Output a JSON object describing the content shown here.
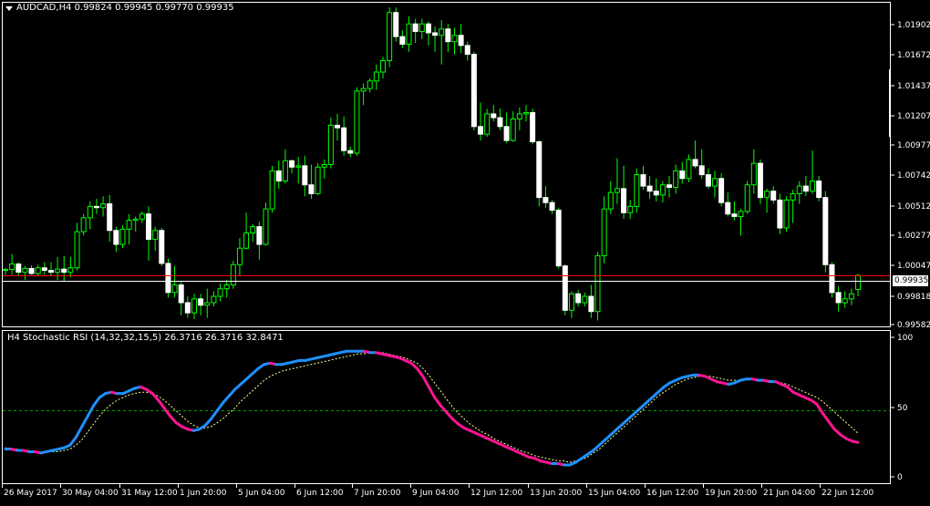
{
  "main_chart": {
    "header": "AUDCAD,H4  0.99824 0.99945 0.99770 0.99935",
    "price_labels": [
      "1.01902",
      "1.01672",
      "1.01437",
      "1.01207",
      "1.00977",
      "1.00742",
      "1.00512",
      "1.00277",
      "1.00047",
      "0.99818",
      "0.99582"
    ],
    "current_price": "0.99935",
    "bid_line_color": "#ffffff",
    "red_line_color": "#ff0000",
    "bull_color": "#ffffff",
    "bear_color": "#ffffff",
    "wick_color": "#00ff00"
  },
  "indicator": {
    "header": "H4 Stochastic RSI (14,32,32,15,5) 26.3716 26.3716 32.8471",
    "levels": [
      "100",
      "50",
      "0"
    ],
    "rising_color": "#1e90ff",
    "falling_color": "#ff1493",
    "signal_color": "#ffff99",
    "level_line_color": "#00a000"
  },
  "time_axis": {
    "labels": [
      "26 May 2017",
      "30 May 04:00",
      "31 May 12:00",
      "1 Jun 20:00",
      "5 Jun 04:00",
      "6 Jun 12:00",
      "7 Jun 20:00",
      "9 Jun 04:00",
      "12 Jun 12:00",
      "13 Jun 20:00",
      "15 Jun 04:00",
      "16 Jun 12:00",
      "19 Jun 20:00",
      "21 Jun 04:00",
      "22 Jun 12:00"
    ]
  },
  "chart_data": [
    {
      "type": "candlestick",
      "title": "AUDCAD,H4",
      "ylim": [
        0.9954,
        1.0208
      ],
      "candles": [
        [
          0.99982,
          0.99995,
          0.9994,
          0.99982
        ],
        [
          0.99982,
          1.00105,
          0.9994,
          1.00025
        ],
        [
          1.00025,
          1.0004,
          0.99935,
          0.9996
        ],
        [
          0.9996,
          1.0001,
          0.999,
          0.9999
        ],
        [
          0.9999,
          1.00015,
          0.9994,
          0.9995
        ],
        [
          0.9995,
          1.0002,
          0.99935,
          0.99995
        ],
        [
          0.99995,
          1.0004,
          0.9994,
          0.99975
        ],
        [
          0.99975,
          1.0004,
          0.9993,
          0.9996
        ],
        [
          0.9996,
          1.0008,
          0.999,
          0.99985
        ],
        [
          0.99985,
          1.0009,
          0.9989,
          0.9996
        ],
        [
          0.9996,
          1.0008,
          0.9992,
          0.99995
        ],
        [
          0.99995,
          1.0035,
          0.99975,
          1.0028
        ],
        [
          1.0028,
          1.0042,
          1.0025,
          1.0039
        ],
        [
          1.0039,
          1.0052,
          1.003,
          1.0048
        ],
        [
          1.0048,
          1.0054,
          1.0042,
          1.0047
        ],
        [
          1.0047,
          1.0056,
          1.004,
          1.005
        ],
        [
          1.005,
          1.0057,
          1.002,
          1.0029
        ],
        [
          1.0029,
          1.0032,
          1.0012,
          1.0018
        ],
        [
          1.0018,
          1.0033,
          1.0015,
          1.003
        ],
        [
          1.003,
          1.0042,
          1.0018,
          1.0037
        ],
        [
          1.0037,
          1.004,
          1.0028,
          1.0038
        ],
        [
          1.0038,
          1.0044,
          1.0035,
          1.0042
        ],
        [
          1.0042,
          1.0048,
          1.0005,
          1.0022
        ],
        [
          1.0022,
          1.0032,
          1.0013,
          1.0029
        ],
        [
          1.0029,
          1.0031,
          1.0001,
          1.0003
        ],
        [
          1.0003,
          1.0007,
          0.9976,
          0.998
        ],
        [
          0.998,
          1.0001,
          0.9976,
          0.9986
        ],
        [
          0.9986,
          0.9989,
          0.9962,
          0.9972
        ],
        [
          0.9972,
          0.9977,
          0.996,
          0.9964
        ],
        [
          0.9964,
          0.9979,
          0.9959,
          0.9975
        ],
        [
          0.9975,
          0.9979,
          0.9962,
          0.997
        ],
        [
          0.997,
          0.9983,
          0.996,
          0.9972
        ],
        [
          0.9972,
          0.9981,
          0.9969,
          0.9977
        ],
        [
          0.9977,
          0.9987,
          0.9973,
          0.9983
        ],
        [
          0.9983,
          0.999,
          0.9976,
          0.9986
        ],
        [
          0.9986,
          1.0005,
          0.9983,
          1.0002
        ],
        [
          1.0002,
          1.0023,
          0.9993,
          1.0015
        ],
        [
          1.0015,
          1.0043,
          1.0014,
          1.0027
        ],
        [
          1.0027,
          1.0034,
          1.002,
          1.0032
        ],
        [
          1.0032,
          1.0036,
          1.0006,
          1.0018
        ],
        [
          1.0018,
          1.0051,
          1.0017,
          1.0046
        ],
        [
          1.0046,
          1.008,
          1.0043,
          1.0076
        ],
        [
          1.0076,
          1.0084,
          1.0062,
          1.0068
        ],
        [
          1.0068,
          1.0093,
          1.0066,
          1.0084
        ],
        [
          1.0084,
          1.0085,
          1.0074,
          1.0079
        ],
        [
          1.0079,
          1.0087,
          1.0066,
          1.008
        ],
        [
          1.008,
          1.0088,
          1.0056,
          1.0065
        ],
        [
          1.0065,
          1.0081,
          1.0054,
          1.0058
        ],
        [
          1.0058,
          1.0082,
          1.0057,
          1.0079
        ],
        [
          1.0079,
          1.0085,
          1.007,
          1.0081
        ],
        [
          1.0081,
          1.0118,
          1.0078,
          1.0112
        ],
        [
          1.0112,
          1.0121,
          1.01,
          1.011
        ],
        [
          1.011,
          1.0119,
          1.0088,
          1.0092
        ],
        [
          1.0092,
          1.0095,
          1.0087,
          1.009
        ],
        [
          1.009,
          1.0142,
          1.0088,
          1.0139
        ],
        [
          1.0139,
          1.0145,
          1.0128,
          1.0141
        ],
        [
          1.0141,
          1.0149,
          1.0138,
          1.0147
        ],
        [
          1.0147,
          1.016,
          1.014,
          1.0154
        ],
        [
          1.0154,
          1.0166,
          1.0149,
          1.0163
        ],
        [
          1.0163,
          1.0205,
          1.0158,
          1.0201
        ],
        [
          1.0201,
          1.0205,
          1.0178,
          1.0182
        ],
        [
          1.0182,
          1.0187,
          1.0173,
          1.0176
        ],
        [
          1.0176,
          1.0198,
          1.017,
          1.0192
        ],
        [
          1.0192,
          1.0196,
          1.0177,
          1.0186
        ],
        [
          1.0186,
          1.0196,
          1.018,
          1.0192
        ],
        [
          1.0192,
          1.0194,
          1.0175,
          1.0185
        ],
        [
          1.0185,
          1.019,
          1.017,
          1.0183
        ],
        [
          1.0183,
          1.0195,
          1.016,
          1.0188
        ],
        [
          1.0188,
          1.0192,
          1.017,
          1.0178
        ],
        [
          1.0178,
          1.0189,
          1.0168,
          1.0183
        ],
        [
          1.0183,
          1.0192,
          1.0169,
          1.0175
        ],
        [
          1.0175,
          1.0178,
          1.0163,
          1.0168
        ],
        [
          1.0168,
          1.017,
          1.0108,
          1.0111
        ],
        [
          1.0111,
          1.013,
          1.01,
          1.0105
        ],
        [
          1.0105,
          1.0125,
          1.0103,
          1.0121
        ],
        [
          1.0121,
          1.0128,
          1.0115,
          1.0118
        ],
        [
          1.0118,
          1.0125,
          1.0108,
          1.0111
        ],
        [
          1.0111,
          1.0122,
          1.0098,
          1.01
        ],
        [
          1.01,
          1.0123,
          1.0099,
          1.0117
        ],
        [
          1.0117,
          1.0126,
          1.0108,
          1.0121
        ],
        [
          1.0121,
          1.0128,
          1.0115,
          1.0122
        ],
        [
          1.0122,
          1.0125,
          1.0097,
          1.0099
        ],
        [
          1.0099,
          1.01,
          1.0048,
          1.0055
        ],
        [
          1.0055,
          1.0064,
          1.0047,
          1.0051
        ],
        [
          1.0051,
          1.0053,
          1.0042,
          1.0045
        ],
        [
          1.0045,
          1.0047,
          0.9999,
          1.0001
        ],
        [
          1.0001,
          1.0002,
          0.9962,
          0.9966
        ],
        [
          0.9966,
          0.9981,
          0.996,
          0.9979
        ],
        [
          0.9979,
          0.9982,
          0.9969,
          0.9972
        ],
        [
          0.9972,
          0.998,
          0.9969,
          0.9977
        ],
        [
          0.9977,
          0.9986,
          0.996,
          0.9965
        ],
        [
          0.9965,
          1.0012,
          0.9958,
          1.0009
        ],
        [
          1.0009,
          1.0056,
          1.0003,
          1.0046
        ],
        [
          1.0046,
          1.0068,
          1.0042,
          1.0059
        ],
        [
          1.0059,
          1.0086,
          1.005,
          1.0062
        ],
        [
          1.0062,
          1.008,
          1.0038,
          1.0043
        ],
        [
          1.0043,
          1.0053,
          1.0038,
          1.0048
        ],
        [
          1.0048,
          1.0078,
          1.0043,
          1.0073
        ],
        [
          1.0073,
          1.008,
          1.0061,
          1.0064
        ],
        [
          1.0064,
          1.0072,
          1.0054,
          1.006
        ],
        [
          1.006,
          1.007,
          1.0052,
          1.0057
        ],
        [
          1.0057,
          1.0068,
          1.0051,
          1.0065
        ],
        [
          1.0065,
          1.0072,
          1.0055,
          1.0063
        ],
        [
          1.0063,
          1.0081,
          1.0058,
          1.0076
        ],
        [
          1.0076,
          1.0083,
          1.0066,
          1.007
        ],
        [
          1.007,
          1.0089,
          1.0067,
          1.0085
        ],
        [
          1.0085,
          1.01,
          1.0078,
          1.008
        ],
        [
          1.008,
          1.0093,
          1.007,
          1.0073
        ],
        [
          1.0073,
          1.0078,
          1.0062,
          1.0064
        ],
        [
          1.0064,
          1.0076,
          1.0055,
          1.007
        ],
        [
          1.007,
          1.0074,
          1.0048,
          1.0051
        ],
        [
          1.0051,
          1.0059,
          1.004,
          1.0042
        ],
        [
          1.0042,
          1.0052,
          1.0037,
          1.004
        ],
        [
          1.004,
          1.0046,
          1.0025,
          1.0044
        ],
        [
          1.0044,
          1.0068,
          1.0042,
          1.0065
        ],
        [
          1.0065,
          1.0093,
          1.0058,
          1.0082
        ],
        [
          1.0082,
          1.0085,
          1.005,
          1.0055
        ],
        [
          1.0055,
          1.0062,
          1.0043,
          1.006
        ],
        [
          1.006,
          1.0064,
          1.005,
          1.0053
        ],
        [
          1.0053,
          1.0058,
          1.0026,
          1.0031
        ],
        [
          1.0031,
          1.0056,
          1.0028,
          1.0053
        ],
        [
          1.0053,
          1.0061,
          1.0035,
          1.0058
        ],
        [
          1.0058,
          1.0068,
          1.005,
          1.0064
        ],
        [
          1.0064,
          1.0072,
          1.0056,
          1.006
        ],
        [
          1.006,
          1.0092,
          1.0058,
          1.0068
        ],
        [
          1.0068,
          1.0072,
          1.0052,
          1.0055
        ],
        [
          1.0055,
          1.006,
          0.9996,
          1.0002
        ],
        [
          1.0002,
          1.0004,
          0.9976,
          0.998
        ],
        [
          0.998,
          0.9985,
          0.9965,
          0.9972
        ],
        [
          0.9972,
          0.9981,
          0.9968,
          0.9975
        ],
        [
          0.9975,
          0.9983,
          0.997,
          0.9979
        ],
        [
          0.99824,
          0.99945,
          0.9977,
          0.99935
        ]
      ]
    },
    {
      "type": "line",
      "title": "H4 Stochastic RSI (14,32,32,15,5)",
      "ylim": [
        0,
        100
      ],
      "reference_line": 50,
      "series": [
        {
          "values": [
            21,
            21,
            20,
            20,
            19,
            19,
            18,
            19,
            20,
            21,
            22,
            24,
            30,
            38,
            46,
            54,
            60,
            63,
            64,
            63,
            63,
            65,
            67,
            68,
            66,
            63,
            58,
            52,
            46,
            41,
            38,
            36,
            35,
            36,
            39,
            44,
            50,
            56,
            61,
            66,
            70,
            74,
            78,
            82,
            85,
            86,
            85,
            85,
            86,
            87,
            88,
            88,
            89,
            90,
            91,
            92,
            93,
            94,
            95,
            95,
            95,
            95,
            94,
            94,
            93,
            92,
            91,
            90,
            88,
            86,
            82,
            76,
            68,
            60,
            54,
            49,
            44,
            40,
            37,
            35,
            33,
            31,
            29,
            27,
            25,
            23,
            21,
            19,
            17,
            15,
            14,
            12,
            11,
            10,
            10,
            9,
            9,
            11,
            14,
            17,
            20,
            24,
            28,
            32,
            36,
            40,
            44,
            48,
            52,
            56,
            60,
            64,
            68,
            71,
            73,
            75,
            76,
            77,
            77,
            76,
            74,
            72,
            71,
            70,
            71,
            73,
            74,
            74,
            73,
            73,
            72,
            72,
            70,
            68,
            64,
            62,
            60,
            58,
            55,
            48,
            42,
            36,
            32,
            29,
            27,
            26
          ]
        },
        {
          "values": [
            22,
            21,
            21,
            20,
            20,
            19,
            19,
            19,
            19,
            19,
            20,
            21,
            24,
            28,
            34,
            40,
            46,
            51,
            55,
            58,
            60,
            62,
            63,
            64,
            64,
            63,
            61,
            58,
            54,
            50,
            46,
            42,
            39,
            37,
            37,
            38,
            41,
            44,
            48,
            52,
            57,
            61,
            65,
            69,
            73,
            76,
            78,
            80,
            81,
            82,
            83,
            84,
            85,
            86,
            87,
            88,
            89,
            90,
            91,
            92,
            93,
            93,
            94,
            94,
            94,
            93,
            92,
            91,
            90,
            88,
            86,
            82,
            77,
            71,
            65,
            59,
            53,
            48,
            44,
            40,
            37,
            34,
            32,
            29,
            27,
            25,
            23,
            21,
            19,
            18,
            16,
            15,
            14,
            13,
            12,
            12,
            11,
            12,
            13,
            15,
            18,
            21,
            25,
            29,
            33,
            37,
            41,
            45,
            49,
            53,
            57,
            61,
            64,
            67,
            70,
            72,
            74,
            75,
            76,
            76,
            76,
            75,
            74,
            73,
            73,
            73,
            74,
            74,
            74,
            73,
            73,
            72,
            71,
            70,
            68,
            66,
            64,
            62,
            60,
            57,
            53,
            49,
            45,
            41,
            37,
            33
          ]
        }
      ]
    }
  ]
}
